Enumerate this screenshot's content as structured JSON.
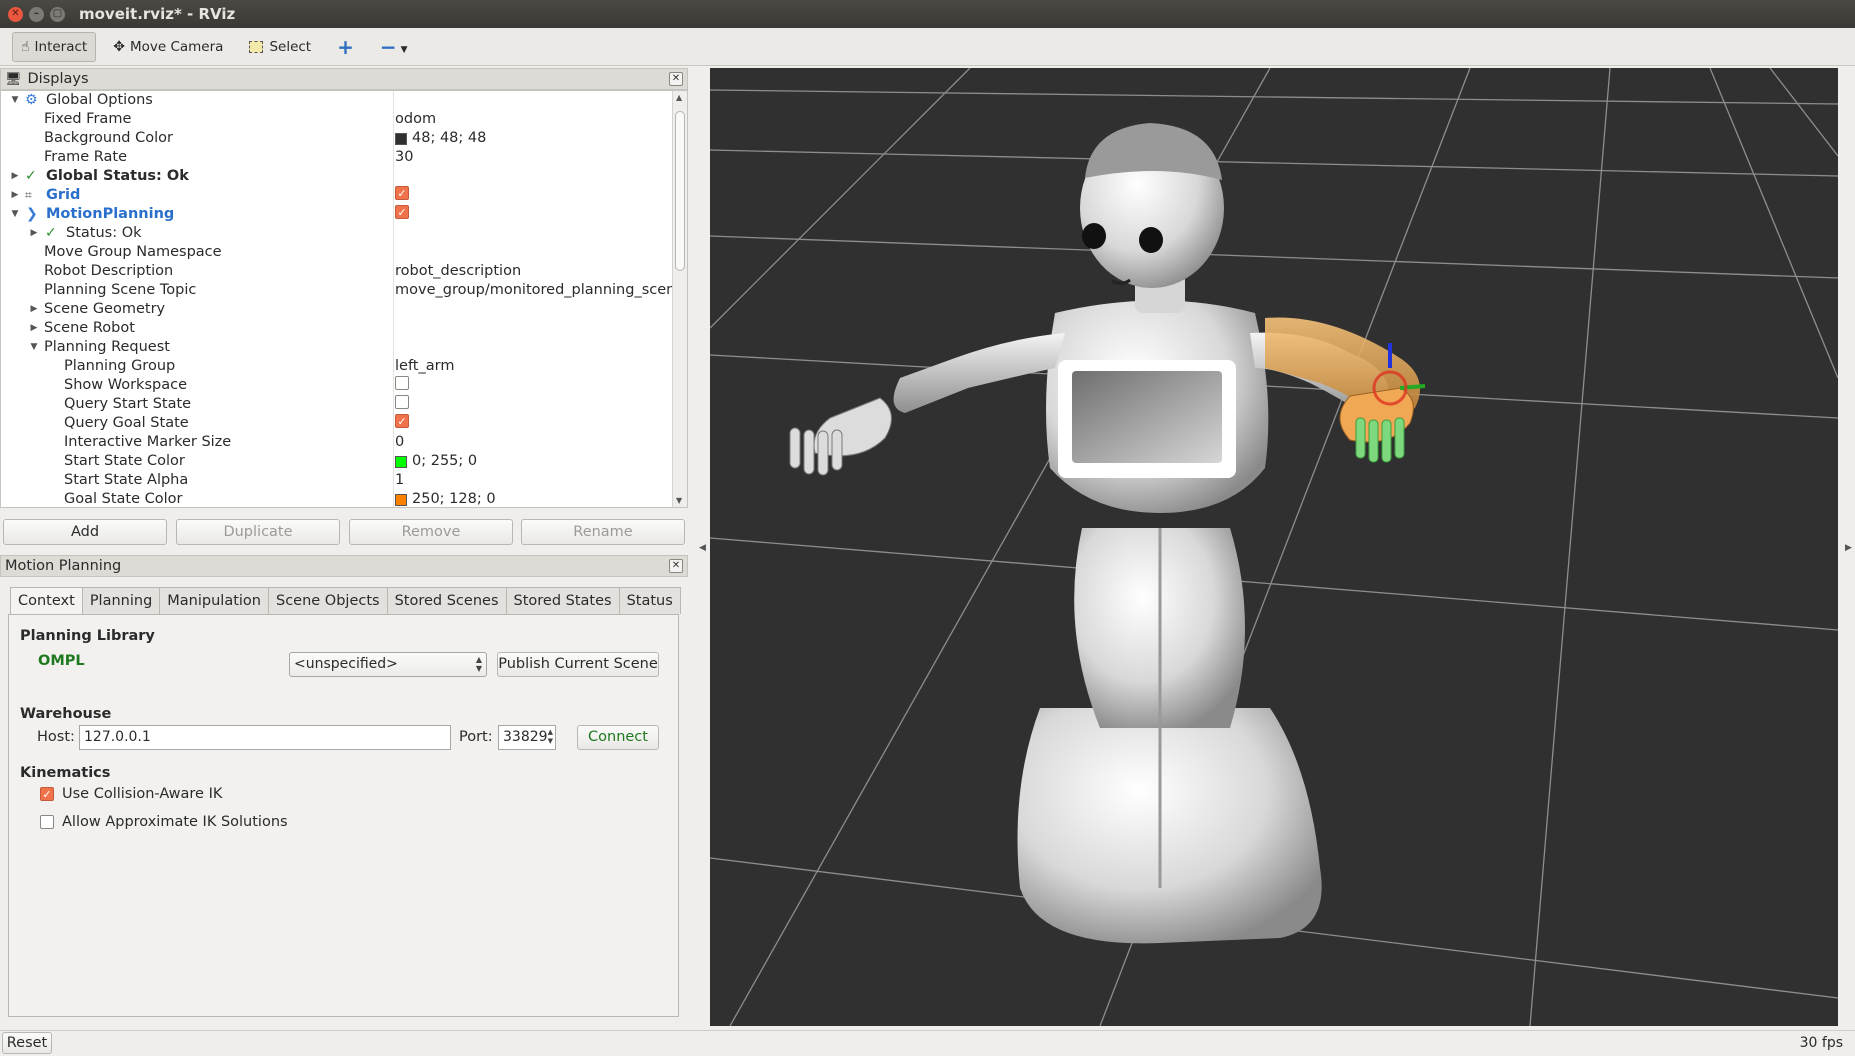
{
  "window": {
    "title": "moveit.rviz* - RViz"
  },
  "toolbar": {
    "interact": "Interact",
    "move_camera": "Move Camera",
    "select": "Select"
  },
  "displays": {
    "title": "Displays",
    "rows": [
      {
        "label": "Global Options",
        "value": ""
      },
      {
        "label": "Fixed Frame",
        "value": "odom"
      },
      {
        "label": "Background Color",
        "value": "48; 48; 48",
        "color": "#303030"
      },
      {
        "label": "Frame Rate",
        "value": "30"
      },
      {
        "label": "Global Status: Ok",
        "value": ""
      },
      {
        "label": "Grid",
        "value": "",
        "checked": true
      },
      {
        "label": "MotionPlanning",
        "value": "",
        "checked": true
      },
      {
        "label": "Status: Ok",
        "value": ""
      },
      {
        "label": "Move Group Namespace",
        "value": ""
      },
      {
        "label": "Robot Description",
        "value": "robot_description"
      },
      {
        "label": "Planning Scene Topic",
        "value": "move_group/monitored_planning_scene"
      },
      {
        "label": "Scene Geometry",
        "value": ""
      },
      {
        "label": "Scene Robot",
        "value": ""
      },
      {
        "label": "Planning Request",
        "value": ""
      },
      {
        "label": "Planning Group",
        "value": "left_arm"
      },
      {
        "label": "Show Workspace",
        "value": "",
        "checked": false
      },
      {
        "label": "Query Start State",
        "value": "",
        "checked": false
      },
      {
        "label": "Query Goal State",
        "value": "",
        "checked": true
      },
      {
        "label": "Interactive Marker Size",
        "value": "0"
      },
      {
        "label": "Start State Color",
        "value": "0; 255; 0",
        "color": "#00ff00"
      },
      {
        "label": "Start State Alpha",
        "value": "1"
      },
      {
        "label": "Goal State Color",
        "value": "250; 128; 0",
        "color": "#fa8000"
      }
    ],
    "buttons": {
      "add": "Add",
      "duplicate": "Duplicate",
      "remove": "Remove",
      "rename": "Rename"
    }
  },
  "motion_planning": {
    "title": "Motion Planning",
    "tabs": [
      "Context",
      "Planning",
      "Manipulation",
      "Scene Objects",
      "Stored Scenes",
      "Stored States",
      "Status"
    ],
    "active_tab": "Context",
    "planning_library": {
      "title": "Planning Library",
      "library": "OMPL",
      "planner": "<unspecified>",
      "publish_button": "Publish Current Scene"
    },
    "warehouse": {
      "title": "Warehouse",
      "host_label": "Host:",
      "host": "127.0.0.1",
      "port_label": "Port:",
      "port": "33829",
      "connect_button": "Connect"
    },
    "kinematics": {
      "title": "Kinematics",
      "collision_aware_ik": "Use Collision-Aware IK",
      "collision_aware_ik_checked": true,
      "approx_ik": "Allow Approximate IK Solutions",
      "approx_ik_checked": false
    }
  },
  "statusbar": {
    "reset": "Reset",
    "fps": "30 fps"
  },
  "colors": {
    "accent": "#f0734b",
    "link_blue": "#2a6fcb",
    "ok_green": "#2f8d2f",
    "viewport_bg": "#303030"
  }
}
